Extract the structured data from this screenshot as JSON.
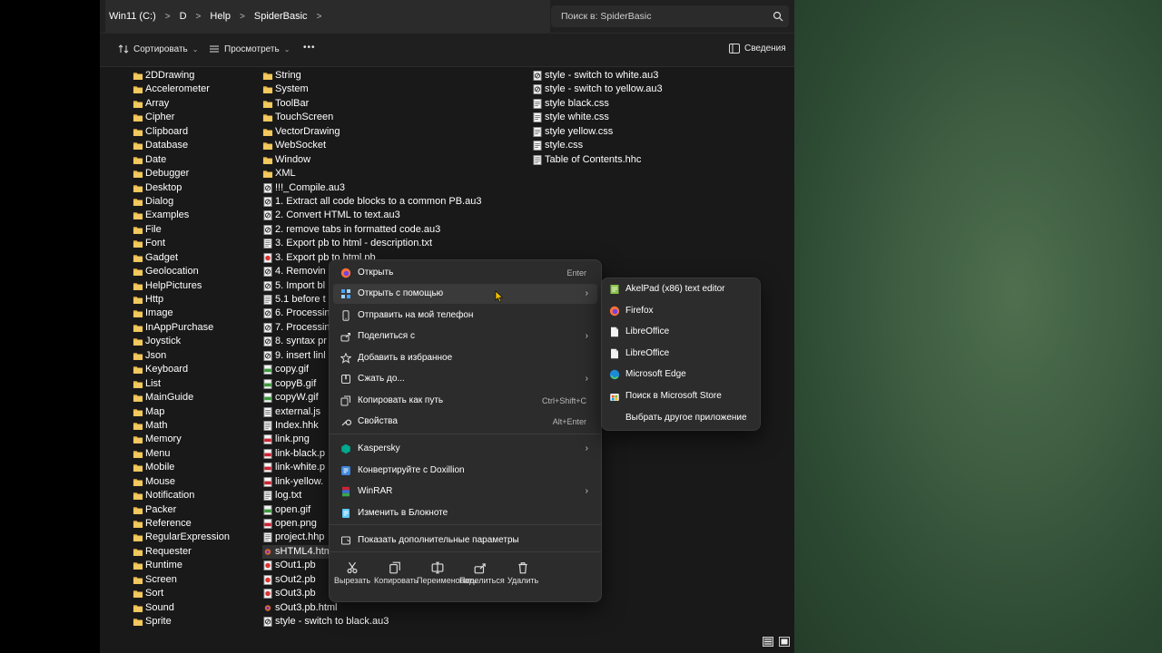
{
  "breadcrumb": [
    "Win11 (C:)",
    "D",
    "Help",
    "SpiderBasic"
  ],
  "search": {
    "placeholder": "Поиск в: SpiderBasic"
  },
  "toolbar": {
    "sort": "Сортировать",
    "view": "Просмотреть",
    "more": "•••",
    "details": "Сведения"
  },
  "colors": {
    "folder": "#e8b64a",
    "window_bg": "#191919",
    "menu_bg": "#2c2c2c",
    "wallpaper": "#3f5e42"
  },
  "files": {
    "col1": [
      {
        "name": "2DDrawing",
        "type": "folder"
      },
      {
        "name": "Accelerometer",
        "type": "folder"
      },
      {
        "name": "Array",
        "type": "folder"
      },
      {
        "name": "Cipher",
        "type": "folder"
      },
      {
        "name": "Clipboard",
        "type": "folder"
      },
      {
        "name": "Database",
        "type": "folder"
      },
      {
        "name": "Date",
        "type": "folder"
      },
      {
        "name": "Debugger",
        "type": "folder"
      },
      {
        "name": "Desktop",
        "type": "folder"
      },
      {
        "name": "Dialog",
        "type": "folder"
      },
      {
        "name": "Examples",
        "type": "folder"
      },
      {
        "name": "File",
        "type": "folder"
      },
      {
        "name": "Font",
        "type": "folder"
      },
      {
        "name": "Gadget",
        "type": "folder"
      },
      {
        "name": "Geolocation",
        "type": "folder"
      },
      {
        "name": "HelpPictures",
        "type": "folder"
      },
      {
        "name": "Http",
        "type": "folder"
      },
      {
        "name": "Image",
        "type": "folder"
      },
      {
        "name": "InAppPurchase",
        "type": "folder"
      },
      {
        "name": "Joystick",
        "type": "folder"
      },
      {
        "name": "Json",
        "type": "folder"
      },
      {
        "name": "Keyboard",
        "type": "folder"
      },
      {
        "name": "List",
        "type": "folder"
      },
      {
        "name": "MainGuide",
        "type": "folder"
      },
      {
        "name": "Map",
        "type": "folder"
      },
      {
        "name": "Math",
        "type": "folder"
      },
      {
        "name": "Memory",
        "type": "folder"
      },
      {
        "name": "Menu",
        "type": "folder"
      },
      {
        "name": "Mobile",
        "type": "folder"
      },
      {
        "name": "Mouse",
        "type": "folder"
      },
      {
        "name": "Notification",
        "type": "folder"
      },
      {
        "name": "Packer",
        "type": "folder"
      },
      {
        "name": "Reference",
        "type": "folder"
      },
      {
        "name": "RegularExpression",
        "type": "folder"
      },
      {
        "name": "Requester",
        "type": "folder"
      },
      {
        "name": "Runtime",
        "type": "folder"
      },
      {
        "name": "Screen",
        "type": "folder"
      },
      {
        "name": "Sort",
        "type": "folder"
      },
      {
        "name": "Sound",
        "type": "folder"
      },
      {
        "name": "Sprite",
        "type": "folder"
      }
    ],
    "col2": [
      {
        "name": "String",
        "type": "folder"
      },
      {
        "name": "System",
        "type": "folder"
      },
      {
        "name": "ToolBar",
        "type": "folder"
      },
      {
        "name": "TouchScreen",
        "type": "folder"
      },
      {
        "name": "VectorDrawing",
        "type": "folder"
      },
      {
        "name": "WebSocket",
        "type": "folder"
      },
      {
        "name": "Window",
        "type": "folder"
      },
      {
        "name": "XML",
        "type": "folder"
      },
      {
        "name": "!!!_Compile.au3",
        "type": "au3"
      },
      {
        "name": "1. Extract all code blocks to a common PB.au3",
        "type": "au3"
      },
      {
        "name": "2. Convert HTML to text.au3",
        "type": "au3"
      },
      {
        "name": "2. remove tabs in formatted code.au3",
        "type": "au3"
      },
      {
        "name": "3. Export pb to html - description.txt",
        "type": "txt"
      },
      {
        "name": "3. Export pb to html.pb",
        "type": "pb"
      },
      {
        "name": "4. Removin",
        "type": "au3"
      },
      {
        "name": "5. Import bl",
        "type": "au3"
      },
      {
        "name": "5.1 before t",
        "type": "txt"
      },
      {
        "name": "6. Processin",
        "type": "au3"
      },
      {
        "name": "7. Processin",
        "type": "au3"
      },
      {
        "name": "8. syntax pr",
        "type": "au3"
      },
      {
        "name": "9. insert linl",
        "type": "au3"
      },
      {
        "name": "copy.gif",
        "type": "gif"
      },
      {
        "name": "copyB.gif",
        "type": "gif"
      },
      {
        "name": "copyW.gif",
        "type": "gif"
      },
      {
        "name": "external.js",
        "type": "js"
      },
      {
        "name": "Index.hhk",
        "type": "hhk"
      },
      {
        "name": "link.png",
        "type": "png"
      },
      {
        "name": "link-black.p",
        "type": "png"
      },
      {
        "name": "link-white.p",
        "type": "png"
      },
      {
        "name": "link-yellow.",
        "type": "png"
      },
      {
        "name": "log.txt",
        "type": "txt"
      },
      {
        "name": "open.gif",
        "type": "gif"
      },
      {
        "name": "open.png",
        "type": "png"
      },
      {
        "name": "project.hhp",
        "type": "hhp"
      },
      {
        "name": "sHTML4.htm",
        "type": "html",
        "selected": true
      },
      {
        "name": "sOut1.pb",
        "type": "pb"
      },
      {
        "name": "sOut2.pb",
        "type": "pb"
      },
      {
        "name": "sOut3.pb",
        "type": "pb"
      },
      {
        "name": "sOut3.pb.html",
        "type": "html"
      },
      {
        "name": "style - switch to black.au3",
        "type": "au3"
      }
    ],
    "col3": [
      {
        "name": "style - switch to white.au3",
        "type": "au3"
      },
      {
        "name": "style - switch to yellow.au3",
        "type": "au3"
      },
      {
        "name": "style black.css",
        "type": "css"
      },
      {
        "name": "style white.css",
        "type": "css"
      },
      {
        "name": "style yellow.css",
        "type": "css"
      },
      {
        "name": "style.css",
        "type": "css"
      },
      {
        "name": "Table of Contents.hhc",
        "type": "hhc"
      }
    ]
  },
  "context_menu": {
    "items": [
      {
        "icon": "firefox-icon",
        "label": "Открыть",
        "shortcut": "Enter"
      },
      {
        "icon": "open-with-icon",
        "label": "Открыть с помощью",
        "arrow": "›"
      },
      {
        "icon": "phone-icon",
        "label": "Отправить на мой телефон"
      },
      {
        "icon": "share-icon",
        "label": "Поделиться с",
        "arrow": "›"
      },
      {
        "icon": "star-icon",
        "label": "Добавить в избранное"
      },
      {
        "icon": "zip-icon",
        "label": "Сжать до...",
        "arrow": "›"
      },
      {
        "icon": "copy-path-icon",
        "label": "Копировать как путь",
        "shortcut": "Ctrl+Shift+C"
      },
      {
        "icon": "wrench-icon",
        "label": "Свойства",
        "shortcut": "Alt+Enter"
      },
      {
        "icon": "kaspersky-icon",
        "label": "Kaspersky",
        "arrow": "›"
      },
      {
        "icon": "doxillion-icon",
        "label": "Конвертируйте с Doxillion"
      },
      {
        "icon": "winrar-icon",
        "label": "WinRAR",
        "arrow": "›"
      },
      {
        "icon": "notepad-icon",
        "label": "Изменить в Блокноте"
      },
      {
        "icon": "more-options-icon",
        "label": "Показать дополнительные параметры"
      }
    ],
    "quick_actions": [
      {
        "icon": "cut-icon",
        "label": "Вырезать"
      },
      {
        "icon": "copy-icon",
        "label": "Копировать"
      },
      {
        "icon": "rename-icon",
        "label": "Переименовать"
      },
      {
        "icon": "share-icon",
        "label": "Поделиться"
      },
      {
        "icon": "delete-icon",
        "label": "Удалить"
      }
    ]
  },
  "open_with_submenu": [
    {
      "icon": "akelpad-icon",
      "label": "AkelPad (x86) text editor"
    },
    {
      "icon": "firefox-icon",
      "label": "Firefox"
    },
    {
      "icon": "libreoffice-icon",
      "label": "LibreOffice"
    },
    {
      "icon": "libreoffice-icon",
      "label": "LibreOffice"
    },
    {
      "icon": "edge-icon",
      "label": "Microsoft Edge"
    },
    {
      "icon": "store-icon",
      "label": "Поиск в Microsoft Store"
    },
    {
      "icon": "",
      "label": "Выбрать другое приложение"
    }
  ]
}
